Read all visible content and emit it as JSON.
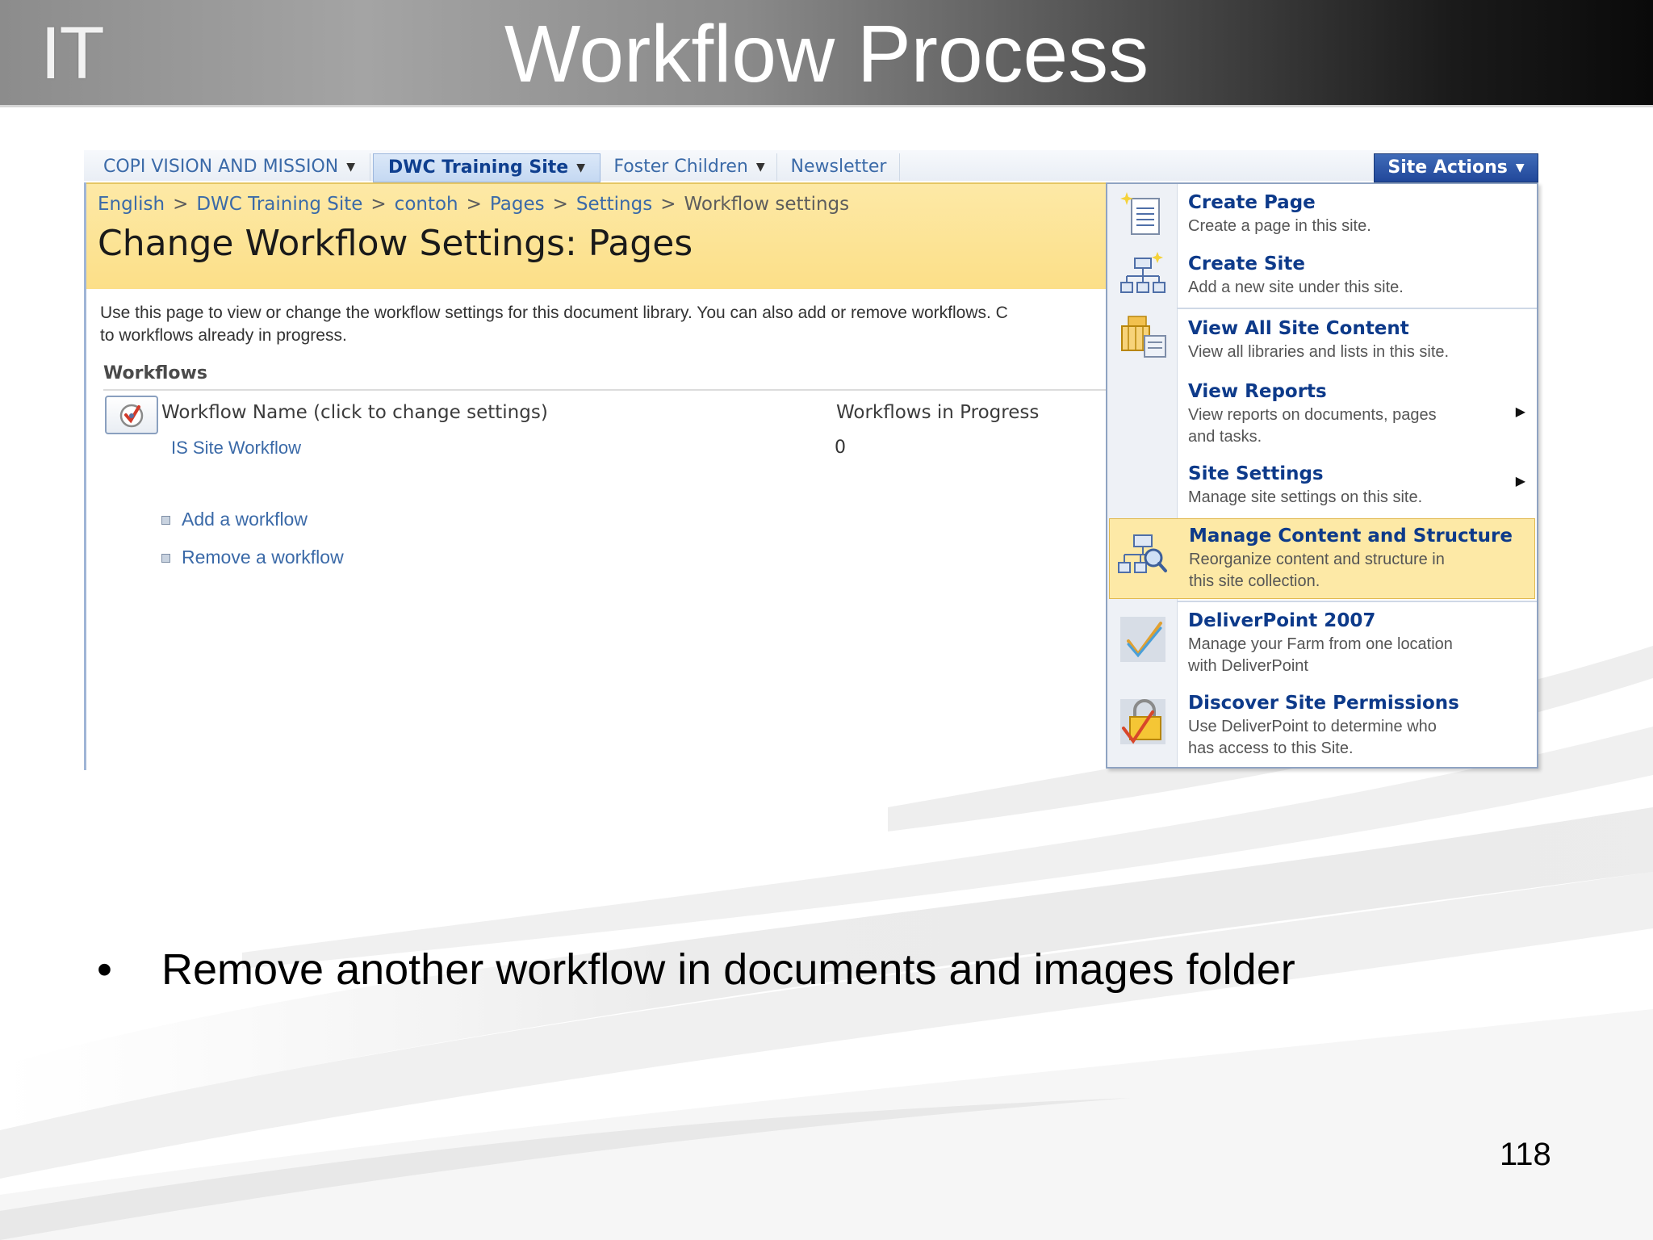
{
  "slide": {
    "logo": "IT",
    "title": "Workflow Process",
    "bullet": "Remove another workflow in documents and images folder",
    "page_number": "118"
  },
  "topnav": {
    "tabs": [
      {
        "label": "COPI VISION AND MISSION",
        "dropdown": true,
        "active": false
      },
      {
        "label": "DWC Training Site",
        "dropdown": true,
        "active": true
      },
      {
        "label": "Foster Children",
        "dropdown": true,
        "active": false
      },
      {
        "label": "Newsletter",
        "dropdown": false,
        "active": false
      }
    ],
    "site_actions": "Site Actions"
  },
  "breadcrumb": [
    "English",
    "DWC Training Site",
    "contoh",
    "Pages",
    "Settings",
    "Workflow settings"
  ],
  "page_heading": "Change Workflow Settings: Pages",
  "description": [
    "Use this page to view or change the workflow settings for this document library. You can also add or remove workflows. C",
    "to workflows already in progress."
  ],
  "workflows": {
    "section_title": "Workflows",
    "col_name": "Workflow Name (click to change settings)",
    "col_progress": "Workflows in Progress",
    "rows": [
      {
        "name": "IS Site Workflow",
        "in_progress": "0"
      }
    ],
    "actions": [
      "Add a workflow",
      "Remove a workflow"
    ]
  },
  "menu": {
    "items": [
      {
        "title": "Create Page",
        "desc": [
          "Create a page in this site."
        ],
        "icon": "create-page-icon",
        "submenu": false,
        "highlight": false
      },
      {
        "title": "Create Site",
        "desc": [
          "Add a new site under this site."
        ],
        "icon": "create-site-icon",
        "submenu": false,
        "highlight": false
      },
      {
        "title": "View All Site Content",
        "desc": [
          "View all libraries and lists in this site."
        ],
        "icon": "site-content-icon",
        "submenu": false,
        "highlight": false
      },
      {
        "title": "View Reports",
        "desc": [
          "View reports on documents, pages",
          "and tasks."
        ],
        "icon": "",
        "submenu": true,
        "highlight": false
      },
      {
        "title": "Site Settings",
        "desc": [
          "Manage site settings on this site."
        ],
        "icon": "",
        "submenu": true,
        "highlight": false
      },
      {
        "title": "Manage Content and Structure",
        "desc": [
          "Reorganize content and structure in",
          "this site collection."
        ],
        "icon": "manage-structure-icon",
        "submenu": false,
        "highlight": true
      },
      {
        "title": "DeliverPoint 2007",
        "desc": [
          "Manage your Farm from one location",
          "with DeliverPoint"
        ],
        "icon": "deliverpoint-check-icon",
        "submenu": false,
        "highlight": false
      },
      {
        "title": "Discover Site Permissions",
        "desc": [
          "Use DeliverPoint to determine who",
          "has access to this Site."
        ],
        "icon": "permissions-lock-icon",
        "submenu": false,
        "highlight": false
      }
    ]
  },
  "colors": {
    "link_blue": "#3b6aa8",
    "menu_title_blue": "#0d3a8a",
    "title_band_yellow": "#fde9a6",
    "site_actions_blue": "#21479a"
  }
}
